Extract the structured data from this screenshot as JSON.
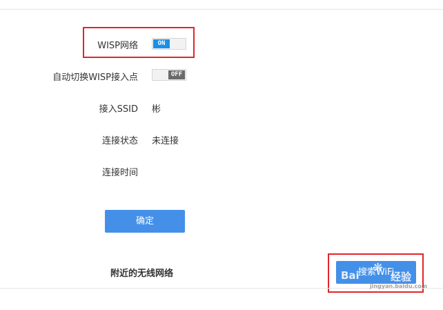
{
  "form": {
    "wisp_label": "WISP网络",
    "wisp_toggle": "ON",
    "auto_switch_label": "自动切换WISP接入点",
    "auto_switch_toggle": "OFF",
    "ssid_label": "接入SSID",
    "ssid_value": "彬",
    "status_label": "连接状态",
    "status_value": "未连接",
    "time_label": "连接时间",
    "time_value": "",
    "confirm_label": "确定"
  },
  "nearby": {
    "title": "附近的无线网络",
    "search_label": "搜索WiFi"
  },
  "watermark": {
    "brand": "Bai",
    "brand_tail": "经验",
    "sub": "jingyan.baidu.com"
  },
  "colors": {
    "accent": "#4490e8",
    "toggle_on": "#1a8fe8",
    "highlight": "#e0242a"
  }
}
